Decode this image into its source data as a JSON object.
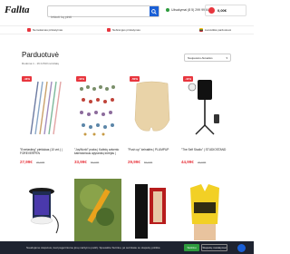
{
  "header": {
    "logo": "Fallta",
    "search_placeholder": "Ieškoti ką pirkti",
    "phone": "Užsakymai (8 5) 299 9934",
    "cart_total": "0,00€"
  },
  "benefits": [
    "Nemokamas pristatymas",
    "Nebrangus pristatymas",
    "Lietuviška parduotuvė"
  ],
  "listing": {
    "title": "Parduotuvė",
    "count": "Rodoma 1 - 16 iš 843 rezultatų",
    "sort": "Naujausios Aktualios"
  },
  "products": [
    {
      "badge": "-43%",
      "name": "\"Everlasting\" pieštukas (10 vnt.) | FOREVERPEN",
      "price": "27,99€",
      "old": "39,99€"
    },
    {
      "badge": "-44%",
      "name": "\"JoyWorld\" praba | Kalėdų advento kalendoriaus apyrankių kūrėjas | ADVENTBRACE",
      "price": "33,99€",
      "old": "59,99€"
    },
    {
      "badge": "-50%",
      "name": "\"Push up\" kelnaitės | PLUMPUP",
      "price": "29,99€",
      "old": "59,99€"
    },
    {
      "badge": "-44%",
      "name": "\"The Self Studio\" | STUDIOSTAND",
      "price": "44,99€",
      "old": "79,99€"
    }
  ],
  "cookie": {
    "text": "Naudojame slapukus, kad pagerintume jūsų naršymo patirtį. Spauskite Sutinku, jei sutinkate su slapukų politika",
    "accept": "Sutinku",
    "settings": "Slapukų nustatymai"
  },
  "colors": {
    "accent": "#e8363e",
    "brand_blue": "#1a5fd6",
    "green": "#2e9b3e"
  }
}
